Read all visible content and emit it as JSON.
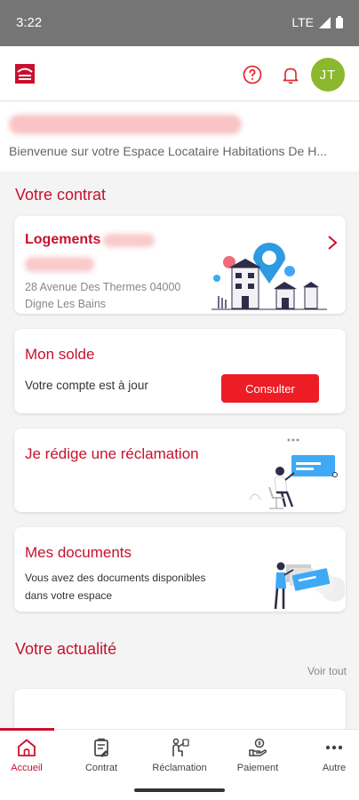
{
  "status_bar": {
    "time": "3:22",
    "network": "LTE"
  },
  "header": {
    "logo_icon": "building-logo-icon",
    "help_icon": "help-circle-icon",
    "bell_icon": "bell-icon",
    "avatar_initials": "JT"
  },
  "welcome": {
    "text": "Bienvenue sur votre Espace Locataire Habitations De H..."
  },
  "contract": {
    "section_title": "Votre contrat",
    "housing_title": "Logements",
    "address_line1": "28 Avenue Des Thermes 04000",
    "address_line2": "Digne Les Bains"
  },
  "balance": {
    "title": "Mon solde",
    "status": "Votre compte est à jour",
    "button": "Consulter"
  },
  "claim": {
    "title": "Je rédige une réclamation"
  },
  "documents": {
    "title": "Mes documents",
    "description_line1": "Vous avez des documents disponibles",
    "description_line2": "dans votre espace"
  },
  "news": {
    "section_title": "Votre actualité",
    "see_all": "Voir tout"
  },
  "nav": {
    "items": [
      {
        "label": "Accueil",
        "icon": "home-icon",
        "active": true
      },
      {
        "label": "Contrat",
        "icon": "contract-icon",
        "active": false
      },
      {
        "label": "Réclamation",
        "icon": "claim-icon",
        "active": false
      },
      {
        "label": "Paiement",
        "icon": "payment-icon",
        "active": false
      },
      {
        "label": "Autre",
        "icon": "more-icon",
        "active": false
      }
    ]
  },
  "colors": {
    "brand_red": "#c8102e",
    "button_red": "#ee1c25",
    "avatar_green": "#8bb82c",
    "status_bar": "#757575"
  }
}
